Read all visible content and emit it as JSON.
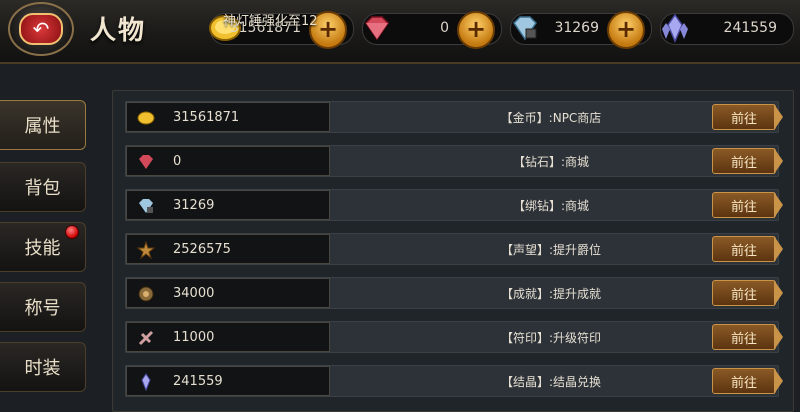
{
  "header": {
    "title": "人物",
    "toast": "神灯锤强化至12"
  },
  "resources": [
    {
      "icon": "gold-coin-icon",
      "value": "31561871"
    },
    {
      "icon": "diamond-icon",
      "value": "0"
    },
    {
      "icon": "bound-diamond-icon",
      "value": "31269"
    },
    {
      "icon": "crystal-icon",
      "value": "241559"
    }
  ],
  "sidebar": {
    "tabs": [
      "属性",
      "背包",
      "技能",
      "称号",
      "时装"
    ]
  },
  "rows": [
    {
      "icon": "gold-coin-icon",
      "value": "31561871",
      "label": "【金币】:NPC商店",
      "button": "前往"
    },
    {
      "icon": "diamond-icon",
      "value": "0",
      "label": "【钻石】:商城",
      "button": "前往"
    },
    {
      "icon": "bound-diamond-icon",
      "value": "31269",
      "label": "【绑钻】:商城",
      "button": "前往"
    },
    {
      "icon": "reputation-icon",
      "value": "2526575",
      "label": "【声望】:提升爵位",
      "button": "前往"
    },
    {
      "icon": "achievement-icon",
      "value": "34000",
      "label": "【成就】:提升成就",
      "button": "前往"
    },
    {
      "icon": "rune-icon",
      "value": "11000",
      "label": "【符印】:升级符印",
      "button": "前往"
    },
    {
      "icon": "crystal-icon",
      "value": "241559",
      "label": "【结晶】:结晶兑换",
      "button": "前往"
    }
  ],
  "colors": {
    "accent": "#c99447",
    "button": "#6e4318",
    "panel": "#20252a"
  }
}
